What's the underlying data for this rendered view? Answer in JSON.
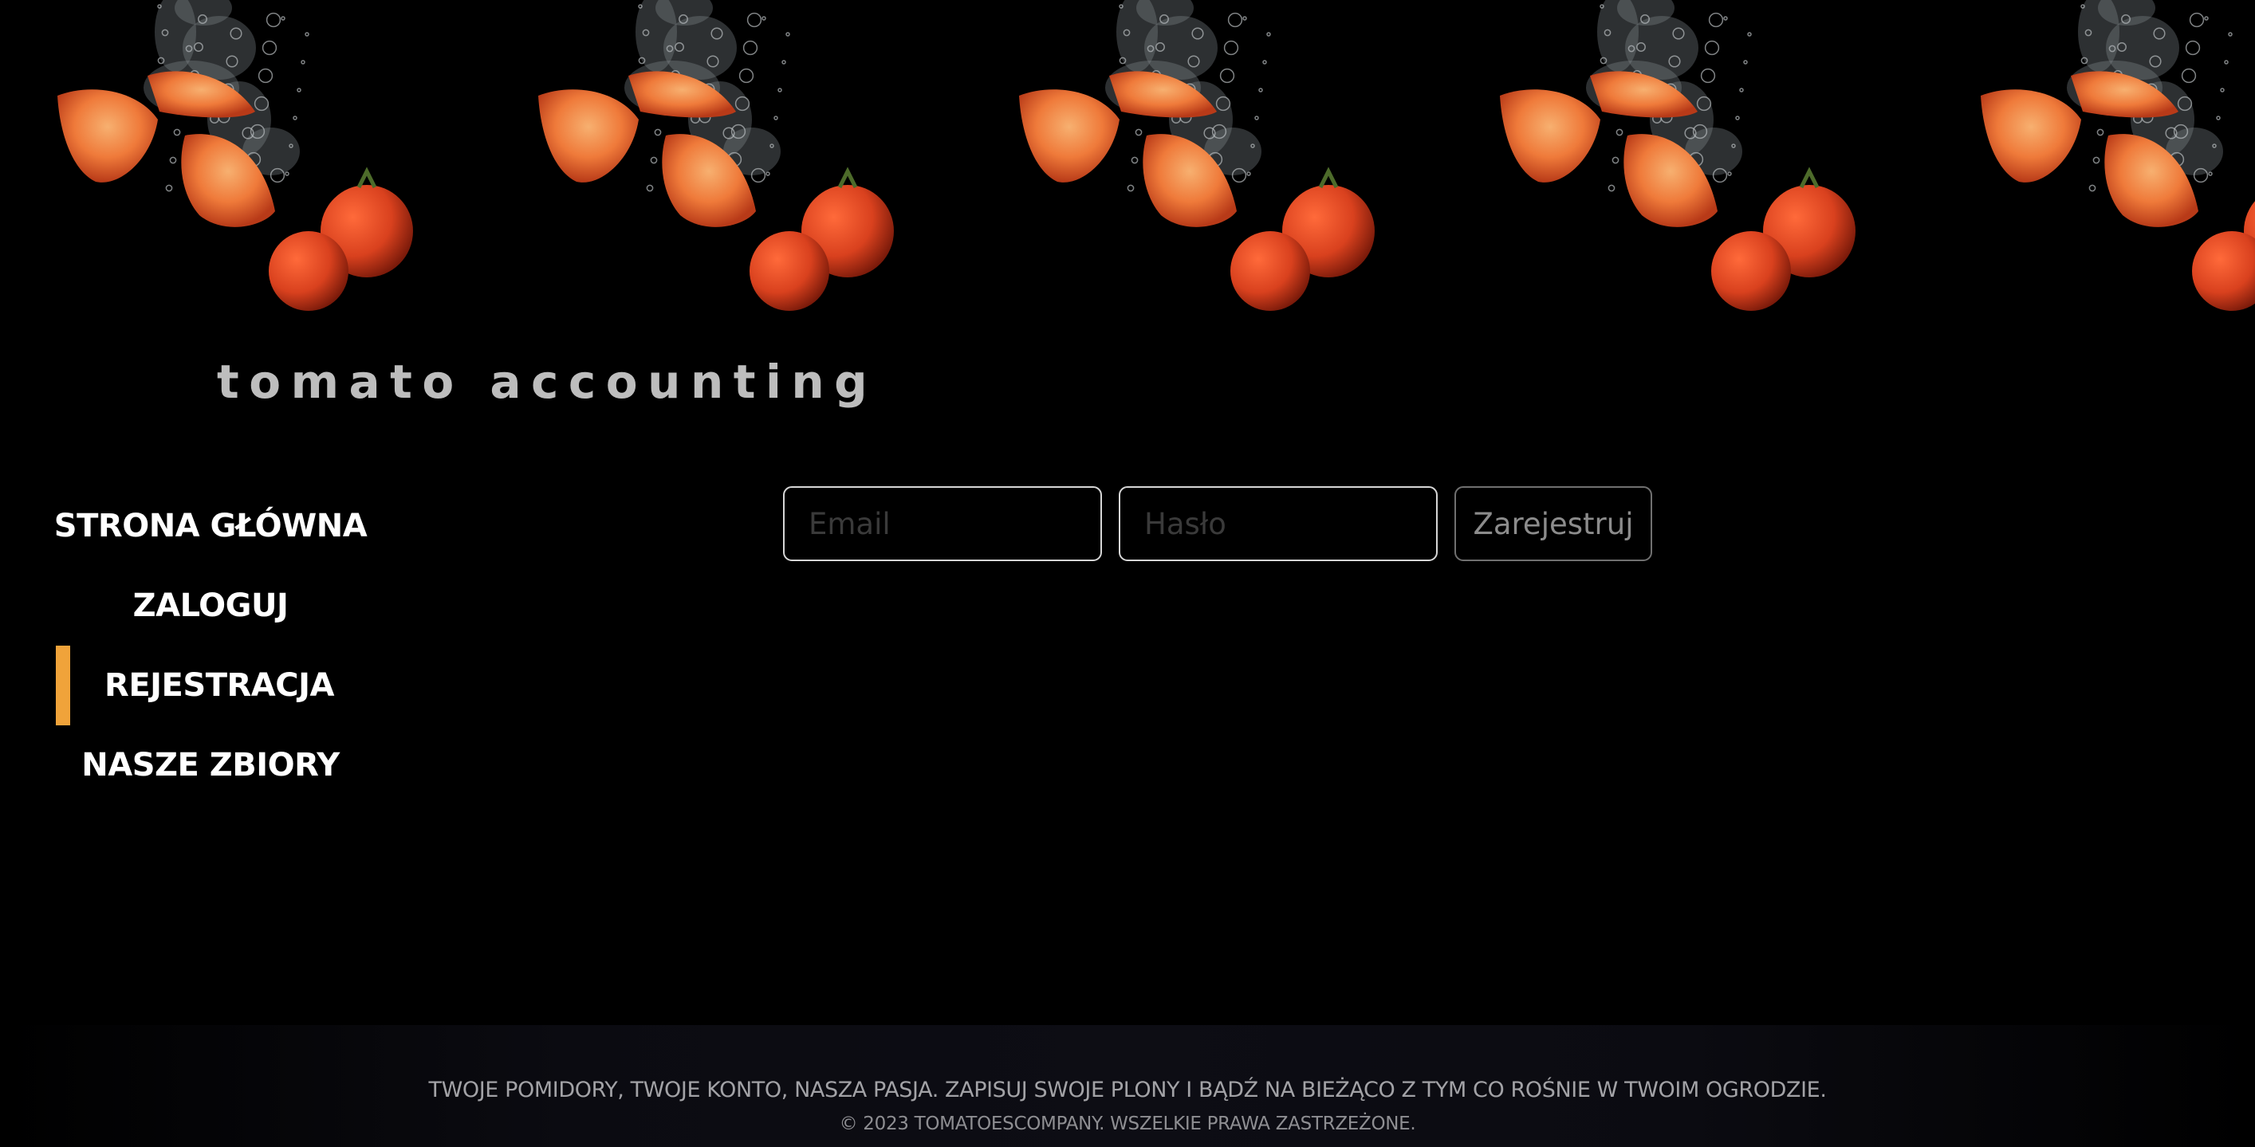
{
  "brand": {
    "logo_text": "tomato accounting"
  },
  "colors": {
    "background": "#000000",
    "accent": "#f0a33a",
    "tomato": "#d9411e"
  },
  "banner": {
    "image": "tomatoes-splashing-in-water-icon"
  },
  "nav": {
    "items": [
      {
        "label": "STRONA GŁÓWNA",
        "active": false
      },
      {
        "label": "ZALOGUJ",
        "active": false
      },
      {
        "label": "REJESTRACJA",
        "active": true
      },
      {
        "label": "NASZE ZBIORY",
        "active": false
      }
    ]
  },
  "form": {
    "email_placeholder": "Email",
    "password_placeholder": "Hasło",
    "submit_label": "Zarejestruj"
  },
  "footer": {
    "tagline": "TWOJE POMIDORY, TWOJE KONTO, NASZA PASJA. ZAPISUJ SWOJE PLONY I BĄDŹ NA BIEŻĄCO Z TYM CO ROŚNIE W TWOIM OGRODZIE.",
    "copyright": "© 2023 TOMATOESCOMPANY. WSZELKIE PRAWA ZASTRZEŻONE."
  }
}
